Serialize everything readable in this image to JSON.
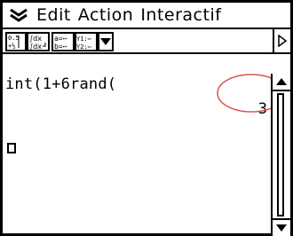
{
  "menubar": {
    "logo_icon": "chevron-double-down-icon",
    "items": [
      {
        "label": "Edit"
      },
      {
        "label": "Action"
      },
      {
        "label": "Interactif"
      }
    ]
  },
  "toolbar": {
    "buttons": [
      {
        "icon": "fraction-decimal-icon",
        "top": "0.5 ▸",
        "bottom": "½"
      },
      {
        "icon": "definite-integral-icon",
        "top": "∫dx",
        "bottom": "∫dx↵"
      },
      {
        "icon": "equation-list-icon",
        "top": "a=···",
        "bottom": "b=···"
      },
      {
        "icon": "function-list-icon",
        "top": "Y1:···",
        "bottom": "Y2:···"
      },
      {
        "icon": "dropdown-arrow-icon"
      }
    ],
    "scroll_right_icon": "triangle-right-icon"
  },
  "work": {
    "input": "int(1+6rand(",
    "result": "3",
    "highlight_color": "#d9534f"
  },
  "scrollbar": {
    "up_icon": "triangle-up-icon",
    "down_icon": "triangle-down-icon"
  }
}
